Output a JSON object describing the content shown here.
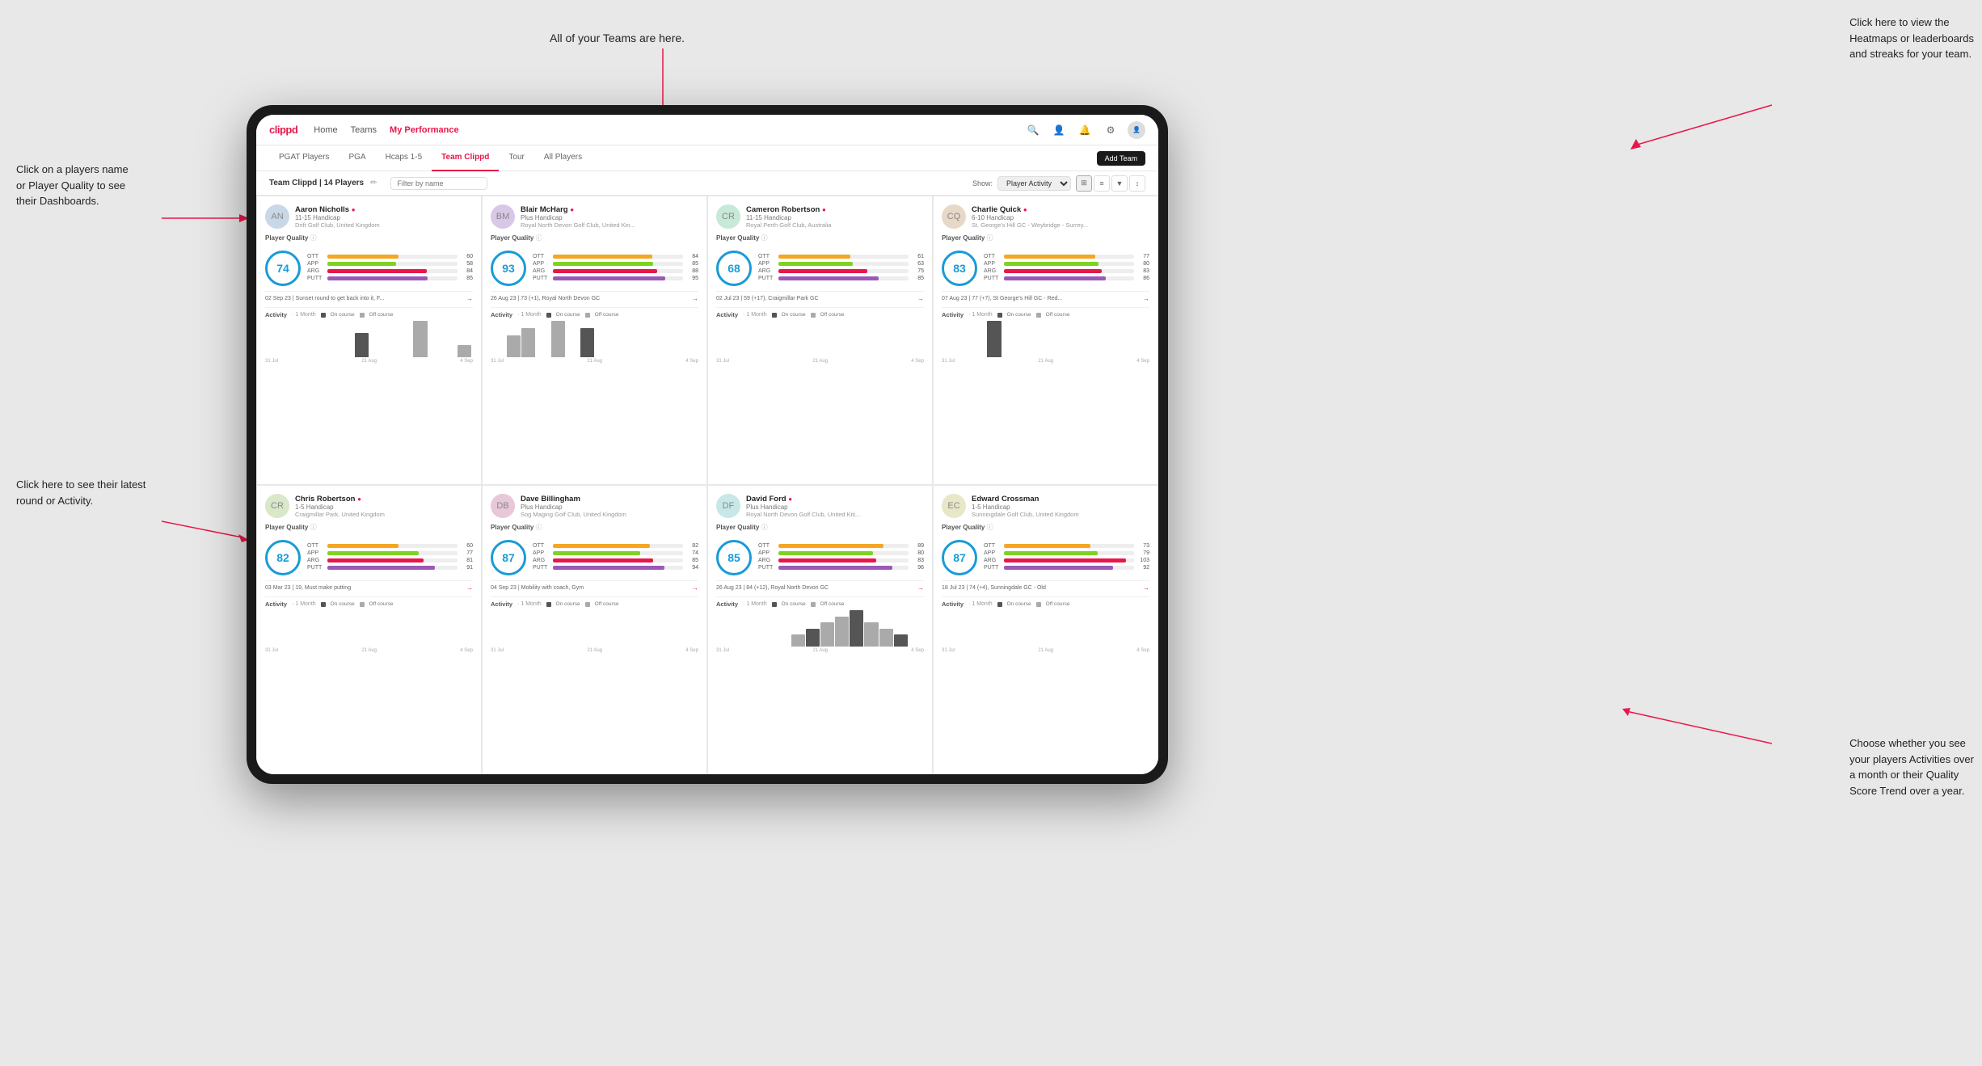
{
  "annotations": {
    "teams_tooltip": "All of your Teams are here.",
    "heatmap_tooltip": "Click here to view the\nHeatmaps or leaderboards\nand streaks for your team.",
    "player_name_tooltip": "Click on a players name\nor Player Quality to see\ntheir Dashboards.",
    "activity_tooltip": "Choose whether you see\nyour players Activities over\na month or their Quality\nScore Trend over a year.",
    "latest_round_tooltip": "Click here to see their latest\nround or Activity."
  },
  "nav": {
    "logo": "clippd",
    "items": [
      "Home",
      "Teams",
      "My Performance"
    ],
    "active": "Teams"
  },
  "tabs": {
    "items": [
      "PGAT Players",
      "PGA",
      "Hcaps 1-5",
      "Team Clippd",
      "Tour",
      "All Players"
    ],
    "active": "Team Clippd",
    "add_button": "Add Team"
  },
  "team_header": {
    "title": "Team Clippd | 14 Players",
    "search_placeholder": "Filter by name",
    "show_label": "Show:",
    "show_options": [
      "Player Activity"
    ],
    "show_selected": "Player Activity"
  },
  "players": [
    {
      "name": "Aaron Nicholls",
      "handicap": "11-15 Handicap",
      "club": "Drift Golf Club, United Kingdom",
      "quality": 74,
      "stats": {
        "OTT": {
          "value": 60,
          "color": "#f5a623"
        },
        "APP": {
          "value": 58,
          "color": "#7ed321"
        },
        "ARG": {
          "value": 84,
          "color": "#e8174a"
        },
        "PUTT": {
          "value": 85,
          "color": "#9b59b6"
        }
      },
      "recent": "02 Sep 23 | Sunset round to get back into it, F...",
      "chart_bars": [
        0,
        0,
        0,
        0,
        0,
        0,
        2,
        0,
        0,
        0,
        3,
        0,
        0,
        1
      ],
      "chart_labels": [
        "31 Jul",
        "21 Aug",
        "4 Sep"
      ]
    },
    {
      "name": "Blair McHarg",
      "handicap": "Plus Handicap",
      "club": "Royal North Devon Golf Club, United Kin...",
      "quality": 93,
      "stats": {
        "OTT": {
          "value": 84,
          "color": "#f5a623"
        },
        "APP": {
          "value": 85,
          "color": "#7ed321"
        },
        "ARG": {
          "value": 88,
          "color": "#e8174a"
        },
        "PUTT": {
          "value": 95,
          "color": "#9b59b6"
        }
      },
      "recent": "26 Aug 23 | 73 (+1), Royal North Devon GC",
      "chart_bars": [
        0,
        3,
        4,
        0,
        5,
        0,
        4,
        0,
        0,
        0,
        0,
        0,
        0,
        0
      ],
      "chart_labels": [
        "31 Jul",
        "21 Aug",
        "4 Sep"
      ]
    },
    {
      "name": "Cameron Robertson",
      "handicap": "11-15 Handicap",
      "club": "Royal Perth Golf Club, Australia",
      "quality": 68,
      "stats": {
        "OTT": {
          "value": 61,
          "color": "#f5a623"
        },
        "APP": {
          "value": 63,
          "color": "#7ed321"
        },
        "ARG": {
          "value": 75,
          "color": "#e8174a"
        },
        "PUTT": {
          "value": 85,
          "color": "#9b59b6"
        }
      },
      "recent": "02 Jul 23 | 59 (+17), Craigmillar Park GC",
      "chart_bars": [
        0,
        0,
        0,
        0,
        0,
        0,
        0,
        0,
        0,
        0,
        0,
        0,
        0,
        0
      ],
      "chart_labels": [
        "31 Jul",
        "21 Aug",
        "4 Sep"
      ]
    },
    {
      "name": "Charlie Quick",
      "handicap": "6-10 Handicap",
      "club": "St. George's Hill GC - Weybridge - Surrey...",
      "quality": 83,
      "stats": {
        "OTT": {
          "value": 77,
          "color": "#f5a623"
        },
        "APP": {
          "value": 80,
          "color": "#7ed321"
        },
        "ARG": {
          "value": 83,
          "color": "#e8174a"
        },
        "PUTT": {
          "value": 86,
          "color": "#9b59b6"
        }
      },
      "recent": "07 Aug 23 | 77 (+7), St George's Hill GC - Red...",
      "chart_bars": [
        0,
        0,
        0,
        2,
        0,
        0,
        0,
        0,
        0,
        0,
        0,
        0,
        0,
        0
      ],
      "chart_labels": [
        "31 Jul",
        "21 Aug",
        "4 Sep"
      ]
    },
    {
      "name": "Chris Robertson",
      "handicap": "1-5 Handicap",
      "club": "Craigmillar Park, United Kingdom",
      "quality": 82,
      "stats": {
        "OTT": {
          "value": 60,
          "color": "#f5a623"
        },
        "APP": {
          "value": 77,
          "color": "#7ed321"
        },
        "ARG": {
          "value": 81,
          "color": "#e8174a"
        },
        "PUTT": {
          "value": 91,
          "color": "#9b59b6"
        }
      },
      "recent": "03 Mar 23 | 19, Must make putting",
      "chart_bars": [
        0,
        0,
        0,
        0,
        0,
        0,
        0,
        0,
        0,
        0,
        0,
        0,
        0,
        0
      ],
      "chart_labels": [
        "31 Jul",
        "21 Aug",
        "4 Sep"
      ]
    },
    {
      "name": "Dave Billingham",
      "handicap": "Plus Handicap",
      "club": "Sog Maging Golf Club, United Kingdom",
      "quality": 87,
      "stats": {
        "OTT": {
          "value": 82,
          "color": "#f5a623"
        },
        "APP": {
          "value": 74,
          "color": "#7ed321"
        },
        "ARG": {
          "value": 85,
          "color": "#e8174a"
        },
        "PUTT": {
          "value": 94,
          "color": "#9b59b6"
        }
      },
      "recent": "04 Sep 23 | Mobility with coach, Gym",
      "chart_bars": [
        0,
        0,
        0,
        0,
        0,
        0,
        0,
        0,
        0,
        0,
        0,
        0,
        0,
        0
      ],
      "chart_labels": [
        "31 Jul",
        "21 Aug",
        "4 Sep"
      ]
    },
    {
      "name": "David Ford",
      "handicap": "Plus Handicap",
      "club": "Royal North Devon Golf Club, United Kiti...",
      "quality": 85,
      "stats": {
        "OTT": {
          "value": 89,
          "color": "#f5a623"
        },
        "APP": {
          "value": 80,
          "color": "#7ed321"
        },
        "ARG": {
          "value": 83,
          "color": "#e8174a"
        },
        "PUTT": {
          "value": 96,
          "color": "#9b59b6"
        }
      },
      "recent": "26 Aug 23 | 84 (+12), Royal North Devon GC",
      "chart_bars": [
        0,
        0,
        0,
        0,
        0,
        2,
        3,
        4,
        5,
        6,
        4,
        3,
        2,
        0
      ],
      "chart_labels": [
        "31 Jul",
        "21 Aug",
        "4 Sep"
      ]
    },
    {
      "name": "Edward Crossman",
      "handicap": "1-5 Handicap",
      "club": "Sunningdale Golf Club, United Kingdom",
      "quality": 87,
      "stats": {
        "OTT": {
          "value": 73,
          "color": "#f5a623"
        },
        "APP": {
          "value": 79,
          "color": "#7ed321"
        },
        "ARG": {
          "value": 103,
          "color": "#e8174a"
        },
        "PUTT": {
          "value": 92,
          "color": "#9b59b6"
        }
      },
      "recent": "18 Jul 23 | 74 (+4), Sunningdale GC - Old",
      "chart_bars": [
        0,
        0,
        0,
        0,
        0,
        0,
        0,
        0,
        0,
        0,
        0,
        0,
        0,
        0
      ],
      "chart_labels": [
        "31 Jul",
        "21 Aug",
        "4 Sep"
      ]
    }
  ],
  "colors": {
    "brand_red": "#e8174a",
    "nav_bg": "#ffffff",
    "card_border": "#e8e8e8",
    "quality_blue": "#1a9bd7",
    "ott_color": "#f5a623",
    "app_color": "#7ed321",
    "arg_color": "#e8174a",
    "putt_color": "#9b59b6",
    "bar_oncourse": "#555555",
    "bar_offcourse": "#aaaaaa"
  }
}
